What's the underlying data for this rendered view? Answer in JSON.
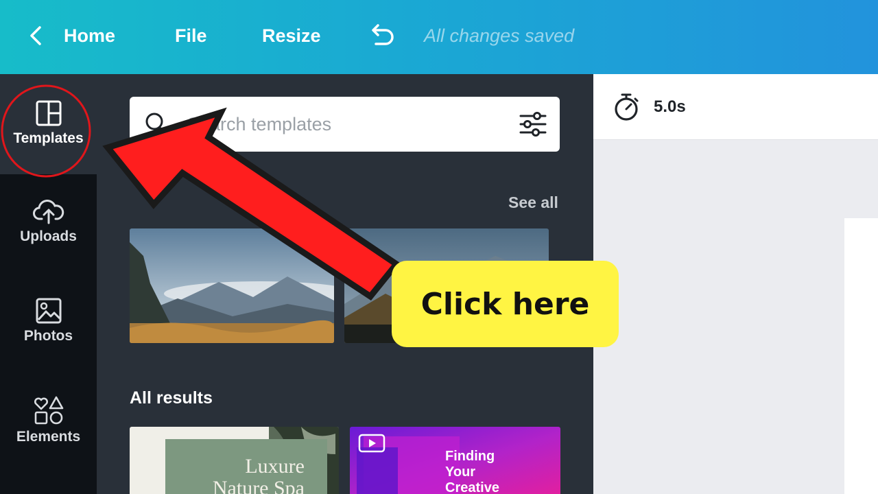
{
  "topbar": {
    "back_icon": "chevron-left-icon",
    "home_label": "Home",
    "file_label": "File",
    "resize_label": "Resize",
    "undo_icon": "undo-icon",
    "save_status": "All changes saved",
    "gradient": [
      "#17bcc9",
      "#2293dc"
    ]
  },
  "sidebar": {
    "items": [
      {
        "label": "Templates",
        "icon": "templates-icon",
        "active": true
      },
      {
        "label": "Uploads",
        "icon": "cloud-upload-icon",
        "active": false
      },
      {
        "label": "Photos",
        "icon": "photo-icon",
        "active": false
      },
      {
        "label": "Elements",
        "icon": "shapes-icon",
        "active": false
      }
    ]
  },
  "panel": {
    "search_placeholder": "Search templates",
    "search_icon": "search-icon",
    "filter_icon": "filter-sliders-icon",
    "see_all_label": "See all",
    "all_results_label": "All results",
    "templates": [
      {
        "title_lines": [
          "Luxure",
          "Nature Spa"
        ]
      },
      {
        "title_lines": [
          "Finding",
          "Your",
          "Creative"
        ],
        "badge_icon": "video-icon"
      }
    ]
  },
  "editor": {
    "timer_icon": "stopwatch-icon",
    "duration": "5.0s"
  },
  "annotation": {
    "callout_text": "Click here",
    "callout_color": "#fff443",
    "arrow_color": "#ff1e1e",
    "circle_color": "#e0161b"
  }
}
